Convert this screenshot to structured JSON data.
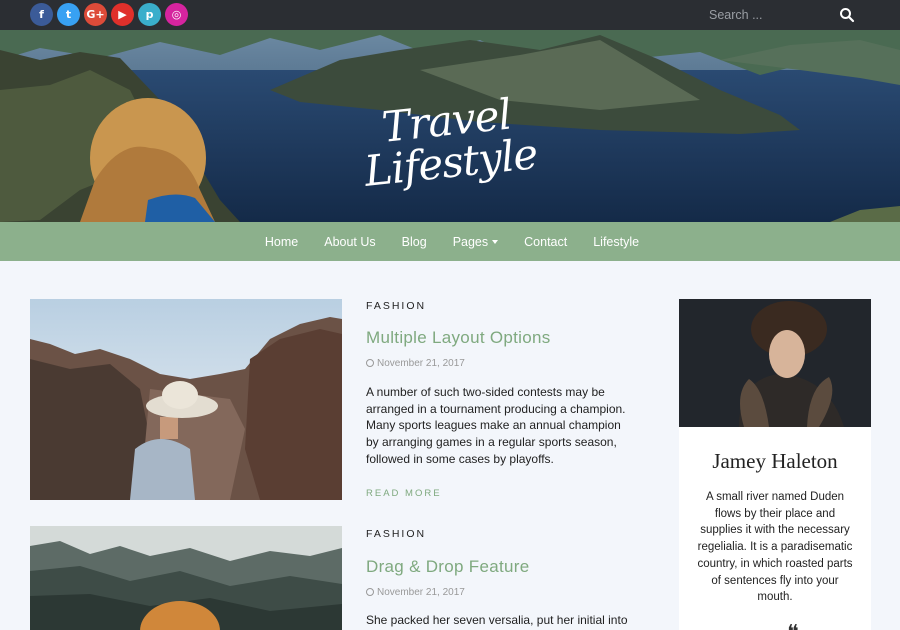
{
  "social": [
    {
      "icon": "facebook-icon",
      "glyph": "f",
      "color": "#3b5b98"
    },
    {
      "icon": "twitter-icon",
      "glyph": "t",
      "color": "#38a1f3"
    },
    {
      "icon": "google-plus-icon",
      "glyph": "G+",
      "color": "#dd4b39"
    },
    {
      "icon": "youtube-icon",
      "glyph": "▶",
      "color": "#e0302b"
    },
    {
      "icon": "pinterest-icon",
      "glyph": "p",
      "color": "#3aaecb"
    },
    {
      "icon": "instagram-icon",
      "glyph": "◎",
      "color": "#d6249f"
    }
  ],
  "search": {
    "placeholder": "Search ..."
  },
  "logo": {
    "text": "Travel Lifestyle"
  },
  "nav": {
    "items": [
      "Home",
      "About Us",
      "Blog",
      "Pages",
      "Contact",
      "Lifestyle"
    ]
  },
  "posts": [
    {
      "category": "FASHION",
      "title": "Multiple Layout Options",
      "date": "November 21, 2017",
      "excerpt": "A number of such two-sided contests may be arranged in a tournament producing a champion. Many sports leagues make an annual champion by arranging games in a regular sports season, followed in some cases by playoffs.",
      "read_more": "READ MORE"
    },
    {
      "category": "FASHION",
      "title": "Drag & Drop Feature",
      "date": "November 21, 2017",
      "excerpt": "She packed her seven versalia, put her initial into"
    }
  ],
  "sidebar": {
    "name": "Jamey Haleton",
    "bio": "A small river named Duden flows by their place and supplies it with the necessary regelialia. It is a paradisematic country, in which roasted parts of sentences fly into your mouth."
  },
  "colors": {
    "accent": "#7fa97f",
    "nav_bg": "#8cb08c",
    "topbar_bg": "#2b2e33"
  }
}
